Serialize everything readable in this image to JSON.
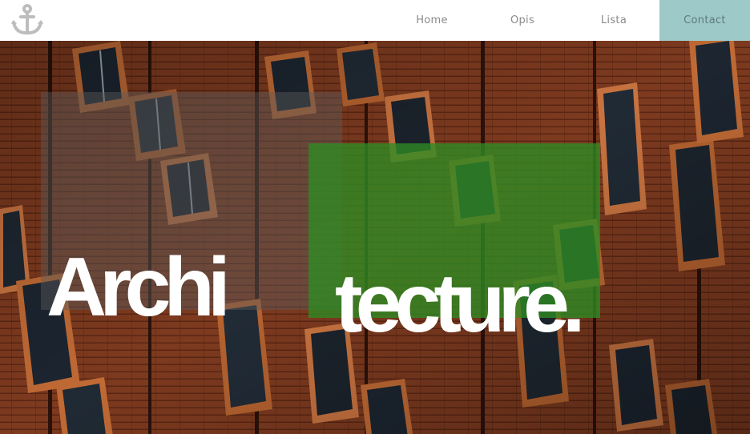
{
  "header": {
    "logo_icon": "anchor-icon",
    "nav": {
      "home": "Home",
      "opis": "Opis",
      "lista": "Lista",
      "contact": "Contact"
    },
    "contact_bg": "#9dc9c9"
  },
  "hero": {
    "title_part1": "Archi",
    "title_part2": "tecture.",
    "overlay_green": "#2e8c24",
    "background_image": "building-facade-photo"
  }
}
